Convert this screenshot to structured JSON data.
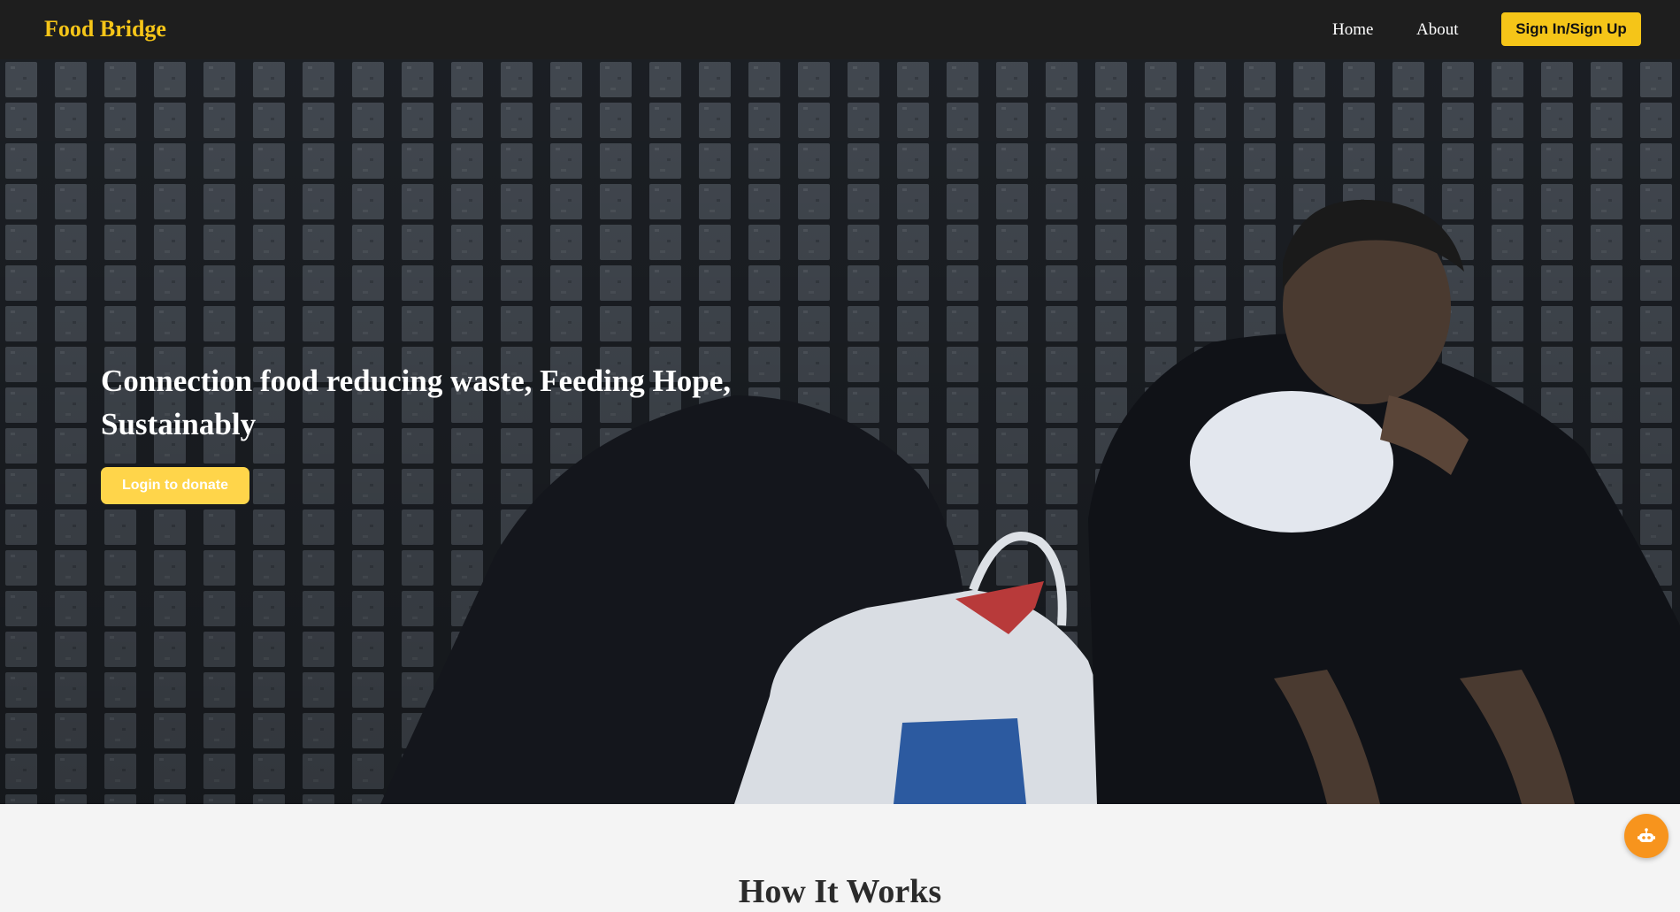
{
  "navbar": {
    "brand": "Food Bridge",
    "links": [
      {
        "label": "Home"
      },
      {
        "label": "About"
      }
    ],
    "signin_label": "Sign In/Sign Up"
  },
  "hero": {
    "title": "Connection food reducing waste, Feeding Hope, Sustainably",
    "cta_label": "Login to donate",
    "background_image": "photo of a person sitting against a brick wall eating from a plastic bag"
  },
  "how_it_works": {
    "title": "How It Works"
  },
  "chat_widget": {
    "icon": "robot-icon"
  },
  "colors": {
    "accent": "#f5c518",
    "nav_bg": "#1e1e1e",
    "chat_button": "#f7941d"
  }
}
